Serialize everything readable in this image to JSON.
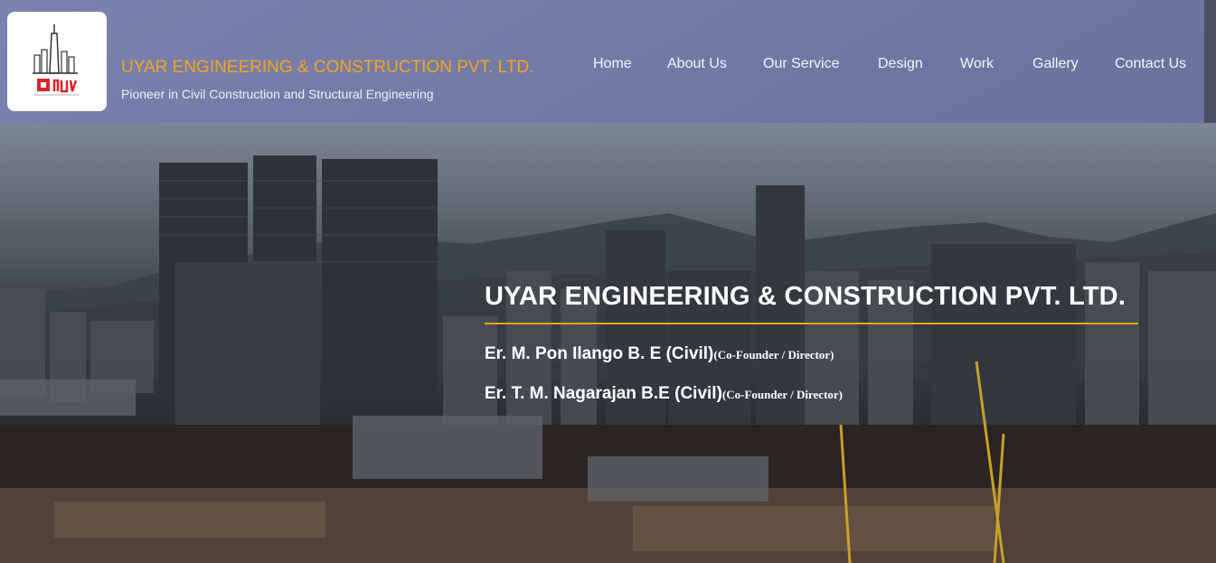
{
  "header": {
    "company_name": "UYAR ENGINEERING & CONSTRUCTION PVT. LTD.",
    "tagline": "Pioneer in Civil Construction and Structural Engineering"
  },
  "nav": {
    "items": [
      {
        "label": "Home"
      },
      {
        "label": "About Us"
      },
      {
        "label": "Our Service"
      },
      {
        "label": "Design"
      },
      {
        "label": "Work"
      },
      {
        "label": "Gallery"
      },
      {
        "label": "Contact Us"
      }
    ]
  },
  "hero": {
    "title": "UYAR ENGINEERING & CONSTRUCTION PVT. LTD.",
    "people": [
      {
        "name": "Er. M. Pon Ilango B. E (Civil)",
        "role": "(Co-Founder / Director)"
      },
      {
        "name": "Er. T. M. Nagarajan B.E (Civil)",
        "role": "(Co-Founder / Director)"
      }
    ]
  },
  "colors": {
    "accent": "#f3a51c",
    "header_bg": "#7a80b2",
    "logo_red": "#d9262c"
  }
}
